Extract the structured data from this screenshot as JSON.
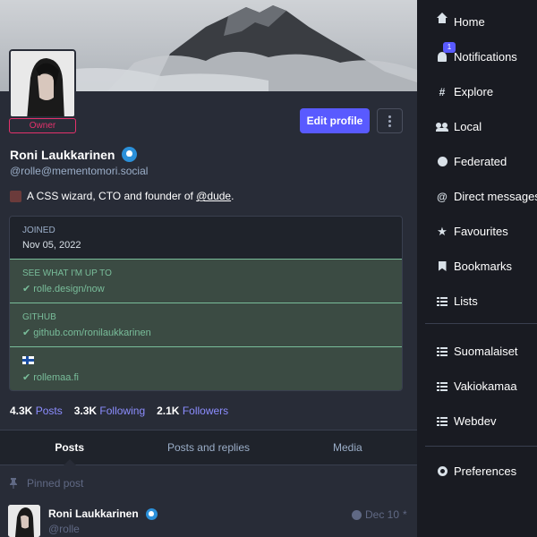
{
  "profile": {
    "role_badge": "Owner",
    "edit_profile_label": "Edit profile",
    "display_name": "Roni Laukkarinen",
    "handle": "@rolle@mementomori.social",
    "bio_text": "A CSS wizard, CTO and founder of",
    "bio_mention": "@dude",
    "bio_end": "."
  },
  "fields": {
    "joined": {
      "label": "JOINED",
      "value": "Nov 05, 2022"
    },
    "items": [
      {
        "label": "SEE WHAT I'M UP TO",
        "value": "rolle.design/now"
      },
      {
        "label": "GITHUB",
        "value": "github.com/ronilaukkarinen"
      },
      {
        "label": "",
        "value": "rollemaa.fi"
      }
    ]
  },
  "counts": {
    "posts_num": "4.3K",
    "posts_label": "Posts",
    "following_num": "3.3K",
    "following_label": "Following",
    "followers_num": "2.1K",
    "followers_label": "Followers"
  },
  "tabs": [
    "Posts",
    "Posts and replies",
    "Media"
  ],
  "pinned": {
    "label": "Pinned post",
    "author": "Roni Laukkarinen",
    "handle": "@rolle",
    "date": "Dec 10",
    "more": "*"
  },
  "nav": {
    "home": "Home",
    "notifications": "Notifications",
    "notifications_badge": "1",
    "explore": "Explore",
    "local": "Local",
    "federated": "Federated",
    "direct": "Direct messages",
    "favourites": "Favourites",
    "bookmarks": "Bookmarks",
    "lists": "Lists",
    "list_items": [
      "Suomalaiset",
      "Vakiokamaa",
      "Webdev"
    ],
    "preferences": "Preferences"
  },
  "colors": {
    "accent": "#595aff",
    "owner_badge": "#e4326c",
    "verified_green": "#79bd9a",
    "verified_blue": "#2b90d9"
  }
}
